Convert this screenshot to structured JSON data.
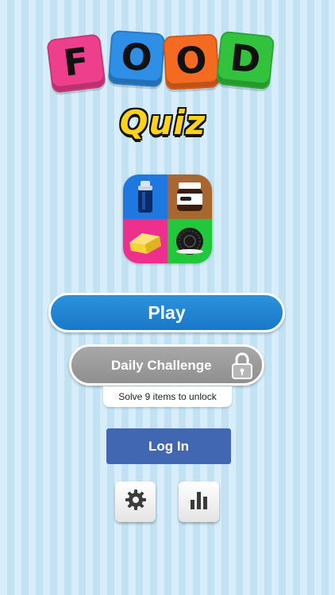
{
  "logo": {
    "letters": [
      "F",
      "O",
      "O",
      "D"
    ],
    "letter_colors": [
      "#ee3f8d",
      "#2f8ee6",
      "#f46a21",
      "#33c23d"
    ],
    "subtitle": "Quiz",
    "subtitle_color": "#ffd21c"
  },
  "food_icon": {
    "quadrants": [
      {
        "icon": "soda-can-icon",
        "color": "#1f78e0"
      },
      {
        "icon": "chocolate-spread-jar-icon",
        "color": "#a8672e"
      },
      {
        "icon": "snack-cake-icon",
        "color": "#ee2f8e"
      },
      {
        "icon": "cookie-icon",
        "color": "#22c83c"
      }
    ]
  },
  "menu": {
    "play_label": "Play",
    "daily_label": "Daily Challenge",
    "daily_locked": true,
    "unlock_note": "Solve 9 items to unlock",
    "login_label": "Log In",
    "settings_icon": "gear-icon",
    "stats_icon": "bar-chart-icon"
  },
  "colors": {
    "play": "#1a78c8",
    "daily": "#999999",
    "login": "#4267b2",
    "background": "#cfe9f7"
  }
}
